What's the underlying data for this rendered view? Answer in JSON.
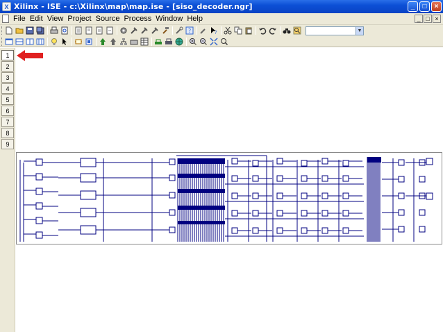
{
  "window": {
    "title": "Xilinx - ISE - c:\\Xilinx\\map\\map.ise - [siso_decoder.ngr]",
    "app_icon_glyph": "X",
    "buttons": {
      "minimize": "_",
      "maximize": "□",
      "close": "×"
    }
  },
  "menubar": {
    "items": [
      "File",
      "Edit",
      "View",
      "Project",
      "Source",
      "Process",
      "Window",
      "Help"
    ],
    "mdi_buttons": {
      "minimize": "_",
      "restore": "□",
      "close": "×"
    }
  },
  "toolbar1": {
    "icons": [
      "new-icon",
      "open-icon",
      "save-icon",
      "save-all-icon",
      "print-icon",
      "print-preview-icon",
      "doc-icon",
      "doc-icon",
      "doc-icon",
      "doc-icon",
      "gear-icon",
      "tool-icon",
      "tool-icon",
      "tool-icon",
      "hammer-icon",
      "help-icon",
      "wrench-icon",
      "help-pointer-icon",
      "cut-icon",
      "copy-icon",
      "paste-icon",
      "undo-icon",
      "redo-icon",
      "binoculars-icon",
      "find-icon"
    ],
    "search_combo_value": ""
  },
  "toolbar2": {
    "icons": [
      "window-icon",
      "window-icon",
      "window-icon",
      "window-icon",
      "bulb-icon",
      "select-arrow-icon",
      "schematic-icon",
      "schematic-icon",
      "push-icon",
      "pop-icon",
      "tree-icon",
      "print-icon",
      "table-icon",
      "connect-icon",
      "net-icon",
      "globe-icon",
      "zoom-in-icon",
      "zoom-out-icon",
      "zoom-fit-icon",
      "zoom-area-icon"
    ]
  },
  "sheet_tabs": [
    "1",
    "2",
    "3",
    "4",
    "5",
    "6",
    "7",
    "8",
    "9"
  ],
  "active_sheet": "1",
  "colors": {
    "title_bar": "#0c4fd6",
    "chrome": "#ece9d8",
    "schematic_wire": "#000080",
    "annotation_arrow": "#e02020"
  }
}
